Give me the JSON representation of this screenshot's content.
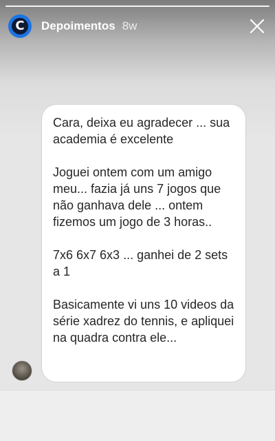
{
  "story": {
    "progress": 1.0
  },
  "header": {
    "account_name": "Depoimentos",
    "time_ago": "8w",
    "logo_letter": "C",
    "logo_icon": "circle-c-logo",
    "close_icon": "close-icon"
  },
  "message": {
    "paragraphs": [
      "Cara, deixa eu agradecer ... sua academia é excelente",
      "Joguei ontem com um amigo meu... fazia já uns 7 jogos que não ganhava dele ... ontem fizemos um jogo de 3 horas..",
      "7x6 6x7 6x3 ... ganhei de 2 sets a 1",
      "Basicamente vi uns 10 videos da série xadrez do tennis, e apliquei na quadra contra ele..."
    ]
  },
  "colors": {
    "logo_blue": "#1b74e4",
    "bubble_bg": "#ffffff",
    "text": "#262626"
  }
}
